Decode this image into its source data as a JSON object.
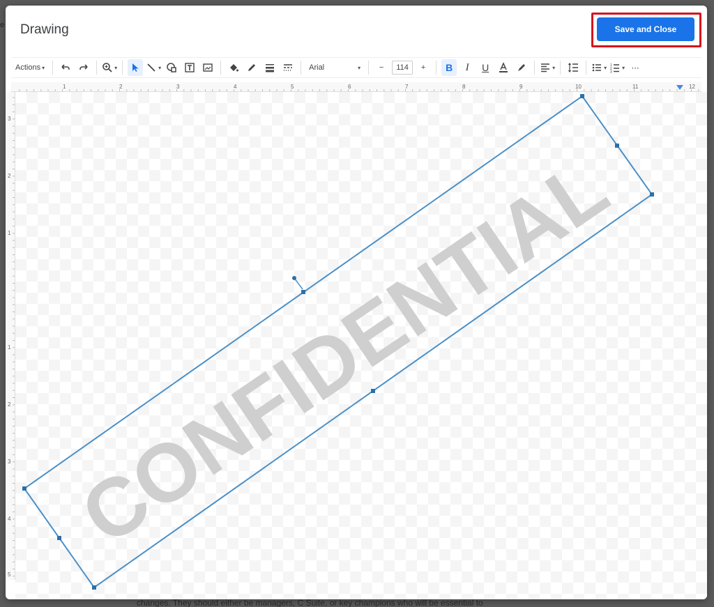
{
  "backdrop": {
    "document_text": "changes. They should either be managers, C Suite, or key champions who will be essential to"
  },
  "dialog": {
    "title": "Drawing",
    "save_close_label": "Save and Close",
    "accent_color": "#1a73e8",
    "highlight_color": "#d4141c"
  },
  "toolbar": {
    "actions_label": "Actions",
    "font_name": "Arial",
    "font_size": "114",
    "icons": [
      "undo-icon",
      "redo-icon",
      "zoom-icon",
      "select-icon",
      "line-icon",
      "shape-icon",
      "text-box-icon",
      "image-icon",
      "fill-color-icon",
      "border-color-icon",
      "border-weight-icon",
      "border-dash-icon",
      "bold-icon",
      "italic-icon",
      "underline-icon",
      "text-color-icon",
      "highlight-icon",
      "align-icon",
      "line-spacing-icon",
      "bulleted-list-icon",
      "numbered-list-icon",
      "more-icon"
    ]
  },
  "ruler": {
    "top": [
      "1",
      "2",
      "3",
      "4",
      "5",
      "6",
      "7",
      "8",
      "9",
      "10",
      "11",
      "12"
    ],
    "left": [
      "3",
      "2",
      "1",
      "1",
      "2",
      "3",
      "4",
      "5"
    ]
  },
  "canvas": {
    "wordart_text": "CONFIDENTIAL"
  }
}
